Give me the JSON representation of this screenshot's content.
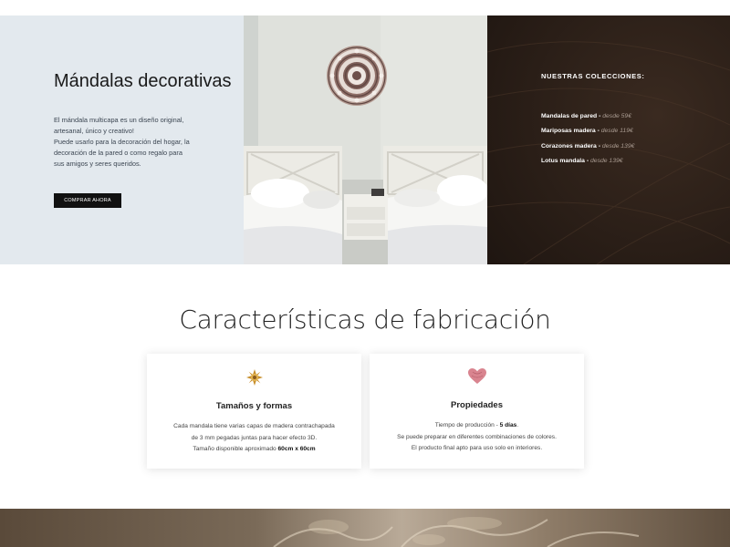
{
  "hero": {
    "title": "Mándalas decorativas",
    "desc_line1": "El mándala multicapa es un diseño original, artesanal, único y creativo!",
    "desc_line2": "Puede usarlo para la decoración del hogar, la decoración de la pared o como regalo para sus amigos y seres queridos.",
    "cta_label": "COMPRAR AHORA",
    "photo_icon": "bedroom-photo"
  },
  "collections": {
    "heading": "NUESTRAS COLECCIONES:",
    "items": [
      {
        "name": "Mandalas de pared",
        "separator": "-",
        "price": "desde 59€"
      },
      {
        "name": "Mariposas madera",
        "separator": "-",
        "price": "desde 119€"
      },
      {
        "name": "Corazones madera",
        "separator": "-",
        "price": "desde 139€"
      },
      {
        "name": "Lotus mandala",
        "separator": "-",
        "price": "desde 139€"
      }
    ]
  },
  "features": {
    "title": "Características de fabricación",
    "cards": [
      {
        "icon": "mandala-icon",
        "heading": "Tamaños y formas",
        "line1": "Cada mandala tiene varias capas de madera contrachapada",
        "line2": "de 3 mm pegadas juntas para hacer efecto 3D.",
        "line3_prefix": "Tamaño disponible aproximado ",
        "line3_bold": "60cm x 60cm"
      },
      {
        "icon": "heart-icon",
        "heading": "Propiedades",
        "line1_prefix": "Tiempo de producción - ",
        "line1_bold": "5 días",
        "line1_suffix": ".",
        "line2": "Se puede preparar en diferentes combinaciones de colores.",
        "line3": "El producto final apto para uso solo en interiores."
      }
    ]
  },
  "colors": {
    "hero_left_bg": "#e3e9ee",
    "hero_right_bg": "#2a1e17",
    "button_bg": "#111111",
    "price_color": "#a89a90"
  }
}
